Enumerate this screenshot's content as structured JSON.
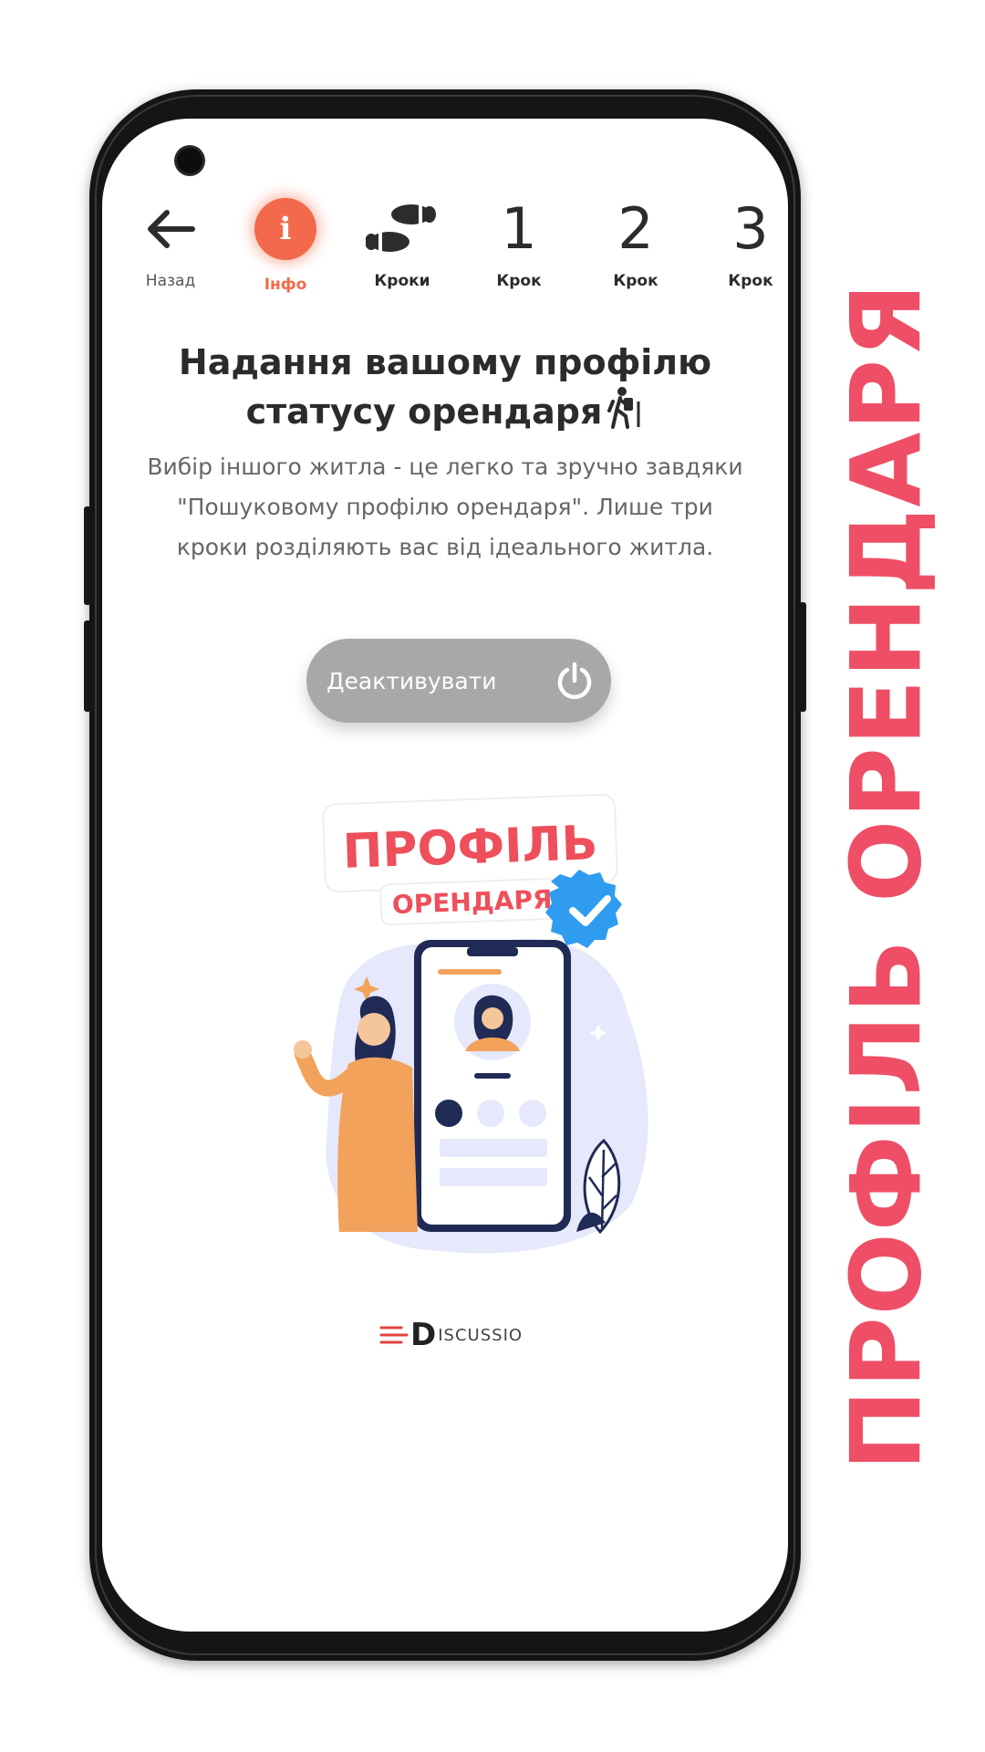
{
  "nav": {
    "back_label": "Назад",
    "info_label": "Інфо",
    "info_glyph": "i",
    "steps_label": "Кроки",
    "step1_number": "1",
    "step1_label": "Крок",
    "step2_number": "2",
    "step2_label": "Крок",
    "step3_number": "3",
    "step3_label": "Крок"
  },
  "main": {
    "title_line1": "Надання вашому профілю",
    "title_line2": "статусу орендаря",
    "description": "Вибір іншого житла - це легко та зручно завдяки \"Пошуковому профілю орендаря\". Лише три кроки розділяють вас від ідеального житла.",
    "deactivate_label": "Деактивувати"
  },
  "illustration": {
    "badge_line1": "ПРОФІЛЬ",
    "badge_line2": "ОРЕНДАРЯ"
  },
  "brand": {
    "first_letter": "D",
    "rest": "ISCUSSIO"
  },
  "side_title": "ПРОФІЛЬ ОРЕНДАРЯ",
  "colors": {
    "accent": "#f26a4b",
    "side_title": "#ee4f66",
    "button_gray": "#a8a8a8",
    "badge_red": "#ee4f5a",
    "verified_blue": "#2f9cf0"
  },
  "icons": [
    "back-arrow-icon",
    "info-icon",
    "footprints-icon",
    "hiker-icon",
    "power-icon",
    "verified-check-icon"
  ]
}
